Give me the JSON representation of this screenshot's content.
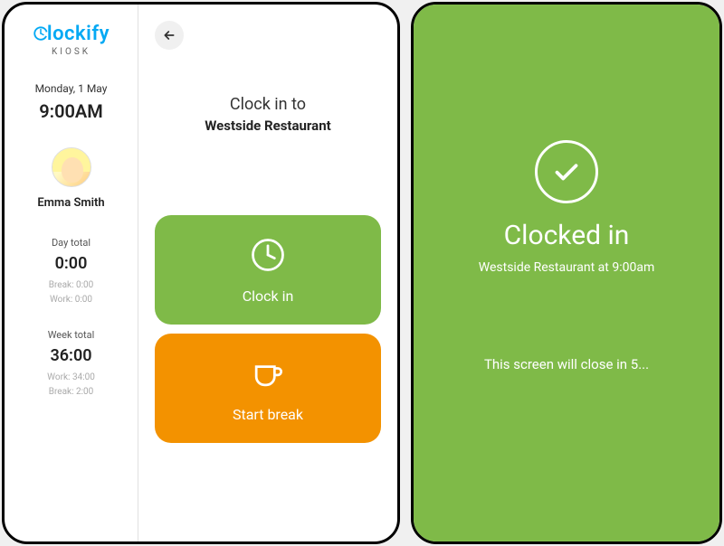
{
  "brand": {
    "name": "Clockify",
    "sub": "KIOSK"
  },
  "sidebar": {
    "date": "Monday, 1 May",
    "time": "9:00AM",
    "user_name": "Emma Smith",
    "day": {
      "label": "Day total",
      "value": "0:00",
      "break": "Break: 0:00",
      "work": "Work: 0:00"
    },
    "week": {
      "label": "Week total",
      "value": "36:00",
      "work": "Work: 34:00",
      "break": "Break: 2:00"
    }
  },
  "main": {
    "title": "Clock in to",
    "location": "Westside Restaurant",
    "clock_in_label": "Clock in",
    "break_label": "Start break"
  },
  "confirm": {
    "title": "Clocked in",
    "subtitle": "Westside Restaurant at 9:00am",
    "footer": "This screen will close in 5..."
  }
}
